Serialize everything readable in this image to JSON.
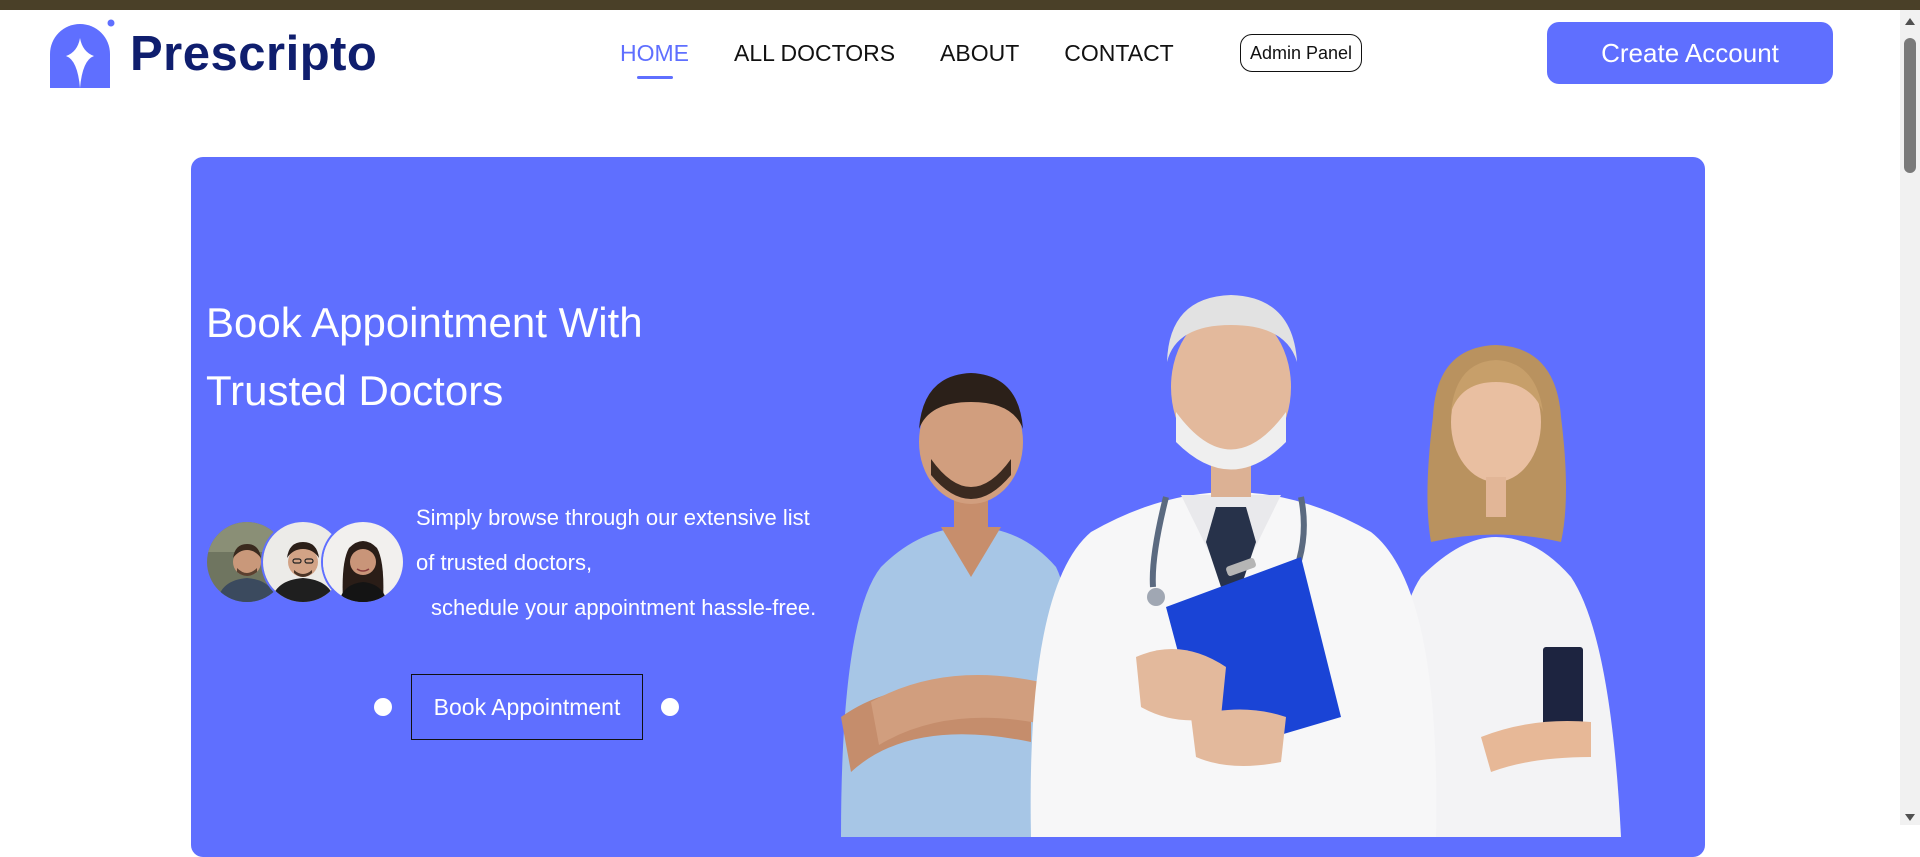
{
  "brand": {
    "name": "Prescripto"
  },
  "nav": {
    "links": [
      {
        "label": "HOME",
        "active": true
      },
      {
        "label": "ALL DOCTORS",
        "active": false
      },
      {
        "label": "ABOUT",
        "active": false
      },
      {
        "label": "CONTACT",
        "active": false
      }
    ],
    "admin_label": "Admin Panel",
    "create_account_label": "Create Account"
  },
  "hero": {
    "title_line1": "Book Appointment With",
    "title_line2": "Trusted Doctors",
    "description": [
      "Simply browse through our extensive list",
      "of trusted doctors,",
      "schedule your appointment hassle-free."
    ],
    "cta_label": "Book Appointment"
  },
  "colors": {
    "primary": "#5f6fff",
    "brand_text": "#0f1e6e",
    "top_strip": "#4a4028"
  }
}
